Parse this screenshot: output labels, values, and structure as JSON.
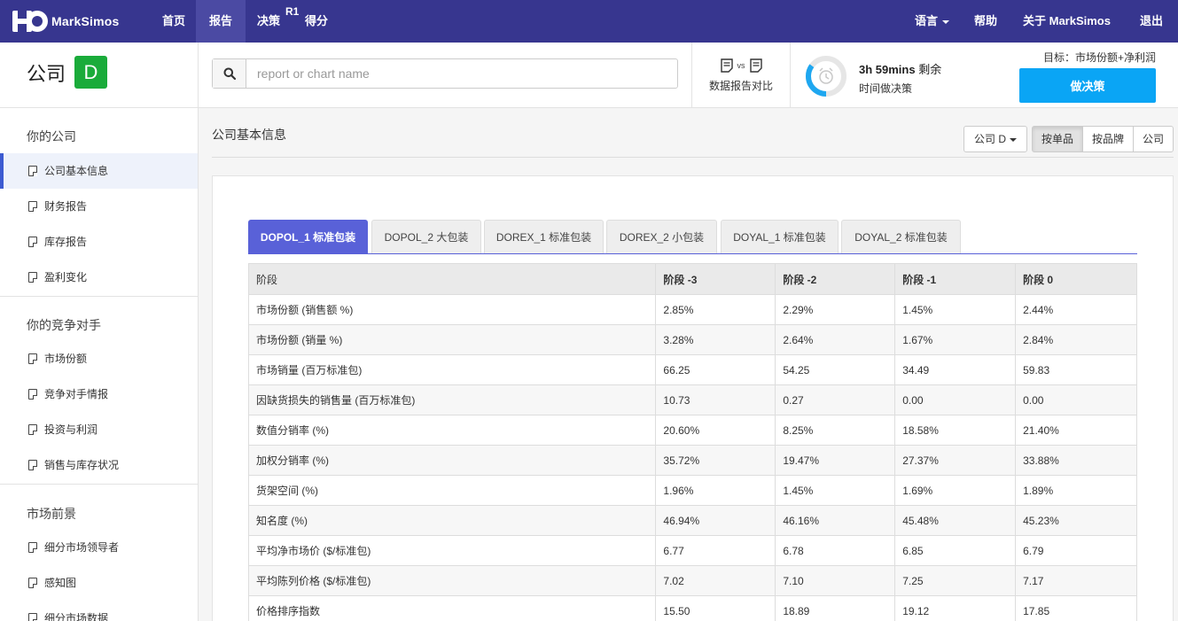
{
  "brand": {
    "name": "MarkSimos"
  },
  "nav": {
    "items": [
      {
        "label": "首页"
      },
      {
        "label": "报告"
      },
      {
        "label": "决策"
      },
      {
        "label": "得分"
      }
    ],
    "round_badge": "R1",
    "right": [
      {
        "label": "语言"
      },
      {
        "label": "帮助"
      },
      {
        "label": "关于 MarkSimos"
      },
      {
        "label": "退出"
      }
    ]
  },
  "header": {
    "company_label": "公司",
    "company_letter": "D",
    "search": {
      "placeholder": "report or chart name",
      "value": ""
    },
    "compare": {
      "vs": "vs",
      "label": "数据报告对比"
    },
    "timer": {
      "remaining": "3h 59mins",
      "remaining_suffix": "剩余",
      "subtitle": "时间做决策",
      "progress": 0.35
    },
    "goal": "目标：市场份额+净利润",
    "decide_button": "做决策"
  },
  "sidebar": {
    "sections": [
      {
        "title": "你的公司",
        "items": [
          "公司基本信息",
          "财务报告",
          "库存报告",
          "盈利变化"
        ]
      },
      {
        "title": "你的竞争对手",
        "items": [
          "市场份额",
          "竞争对手情报",
          "投资与利润",
          "销售与库存状况"
        ]
      },
      {
        "title": "市场前景",
        "items": [
          "细分市场领导者",
          "感知图",
          "细分市场数据"
        ]
      }
    ],
    "active_item": "公司基本信息"
  },
  "main": {
    "title": "公司基本信息",
    "company_dropdown": "公司 D",
    "segments": [
      "按单品",
      "按品牌",
      "公司"
    ],
    "active_segment": "按单品",
    "tabs": [
      "DOPOL_1 标准包装",
      "DOPOL_2 大包装",
      "DOREX_1 标准包装",
      "DOREX_2 小包装",
      "DOYAL_1 标准包装",
      "DOYAL_2 标准包装"
    ],
    "active_tab": "DOPOL_1 标准包装",
    "table": {
      "headers": [
        "阶段",
        "阶段 -3",
        "阶段 -2",
        "阶段 -1",
        "阶段 0"
      ],
      "rows": [
        [
          "市场份额 (销售额 %)",
          "2.85%",
          "2.29%",
          "1.45%",
          "2.44%"
        ],
        [
          "市场份额 (销量 %)",
          "3.28%",
          "2.64%",
          "1.67%",
          "2.84%"
        ],
        [
          "市场销量 (百万标准包)",
          "66.25",
          "54.25",
          "34.49",
          "59.83"
        ],
        [
          "因缺货损失的销售量 (百万标准包)",
          "10.73",
          "0.27",
          "0.00",
          "0.00"
        ],
        [
          "数值分销率 (%)",
          "20.60%",
          "8.25%",
          "18.58%",
          "21.40%"
        ],
        [
          "加权分销率 (%)",
          "35.72%",
          "19.47%",
          "27.37%",
          "33.88%"
        ],
        [
          "货架空间 (%)",
          "1.96%",
          "1.45%",
          "1.69%",
          "1.89%"
        ],
        [
          "知名度 (%)",
          "46.94%",
          "46.16%",
          "45.48%",
          "45.23%"
        ],
        [
          "平均净市场价 ($/标准包)",
          "6.77",
          "6.78",
          "6.85",
          "6.79"
        ],
        [
          "平均陈列价格 ($/标准包)",
          "7.02",
          "7.10",
          "7.25",
          "7.17"
        ],
        [
          "价格排序指数",
          "15.50",
          "18.89",
          "19.12",
          "17.85"
        ]
      ]
    }
  },
  "colors": {
    "nav_bg": "#37368f",
    "accent_tab": "#5961d8",
    "decide_button": "#0aa5f5",
    "company_badge": "#1aab3a",
    "timer_ring": "#1ea7f0"
  }
}
